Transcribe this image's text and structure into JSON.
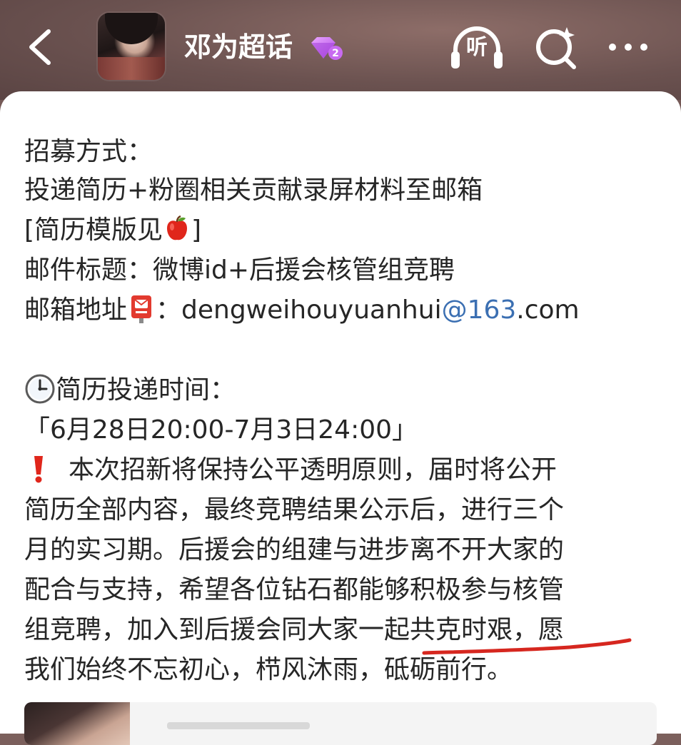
{
  "header": {
    "title": "邓为超话",
    "badge_level": "2",
    "listen_label": "听",
    "back_icon": "chevron-left-icon",
    "search_icon": "search-sparkle-icon",
    "more_icon": "ellipsis-icon"
  },
  "post": {
    "lines": [
      "招募方式：",
      "投递简历+粉圈相关贡献录屏材料至邮箱",
      "[简历模版见",
      "]",
      "邮件标题：微博id+后援会核管组竞聘",
      "邮箱地址",
      "：dengweihouyuanhui",
      "@163",
      ".com",
      "简历投递时间：",
      "「6月28日20:00-7月3日24:00」",
      "本次招新将保持公平透明原则，届时将公开",
      "简历全部内容，最终竞聘结果公示后，进行三个",
      "月的实习期。后援会的组建与进步离不开大家的",
      "配合与支持，希望各位钻石都能够积极参与核管",
      "组竞聘，加入到后援会同大家一起共克时艰，愿",
      "我们始终不忘初心，栉风沐雨，砥砺前行。"
    ],
    "emojis": {
      "apple": "apple-emoji-icon",
      "postbox": "postbox-emoji-icon",
      "clock": "clock-emoji-icon",
      "exclamation": "red-exclamation-icon"
    }
  },
  "colors": {
    "header_bg": "#6b5250",
    "text": "#262626",
    "link": "#3b6fb2",
    "underline_mark": "#d6271f",
    "badge": "#c86bf0"
  }
}
